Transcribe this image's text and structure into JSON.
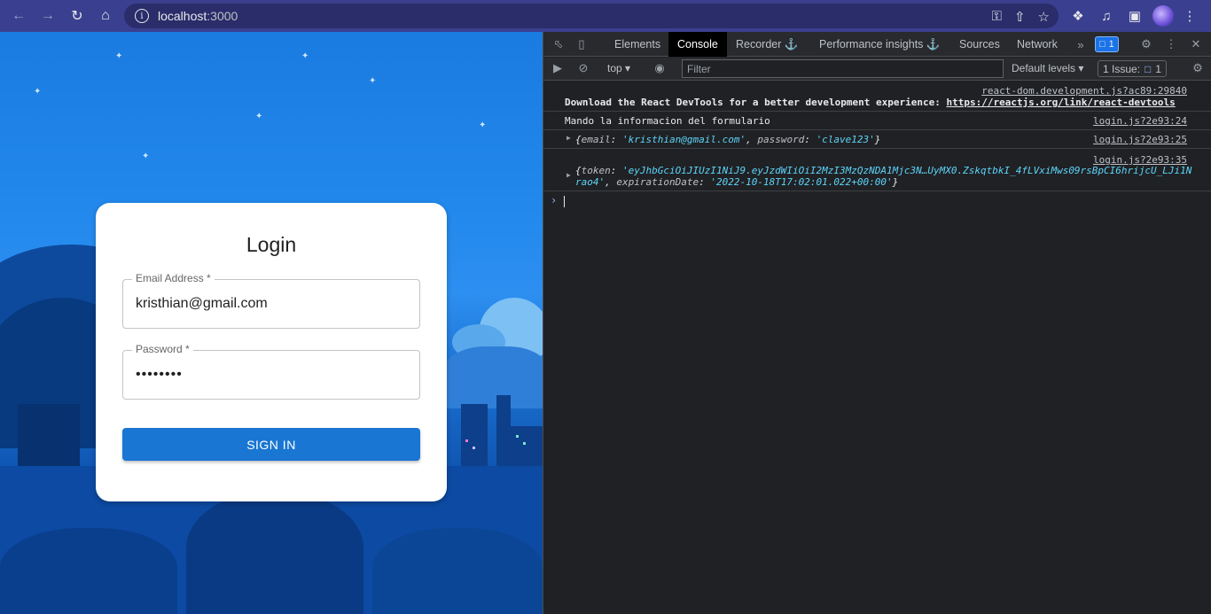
{
  "browser": {
    "url_host": "localhost",
    "url_port": ":3000"
  },
  "login": {
    "title": "Login",
    "email_label": "Email Address *",
    "email_value": "kristhian@gmail.com",
    "password_label": "Password *",
    "password_value": "••••••••",
    "signin_label": "SIGN IN"
  },
  "devtools": {
    "tabs": [
      "Elements",
      "Console",
      "Recorder",
      "Performance insights",
      "Sources",
      "Network"
    ],
    "active_tab": "Console",
    "issues_badge_count": "1",
    "toolbar": {
      "context": "top",
      "filter_placeholder": "Filter",
      "levels": "Default levels",
      "issues_label": "1 Issue:",
      "issues_count": "1"
    },
    "messages": [
      {
        "source": "react-dom.development.js?ac89:29840",
        "text": "Download the React DevTools for a better development experience: ",
        "link": "https://reactjs.org/link/react-devtools"
      },
      {
        "source": "login.js?2e93:24",
        "text": "Mando la informacion del formulario"
      },
      {
        "source": "login.js?2e93:25",
        "obj_open": "{",
        "k1": "email",
        "v1": "'kristhian@gmail.com'",
        "k2": "password",
        "v2": "'clave123'",
        "obj_close": "}"
      },
      {
        "source": "login.js?2e93:35",
        "k1": "token",
        "v1_line1": "'eyJhbGciOiJIUzI1NiJ9.eyJzdWIiOiI2MzI3MzQzNDA1Mjc3N…UyMX0.ZskqtbkI_4fLVxiMws09rsBpCI6hrijcU_LJi1N",
        "v1_line2": "rao4'",
        "k2": "expirationDate",
        "v2": "'2022-10-18T17:02:01.022+00:00'"
      }
    ]
  }
}
